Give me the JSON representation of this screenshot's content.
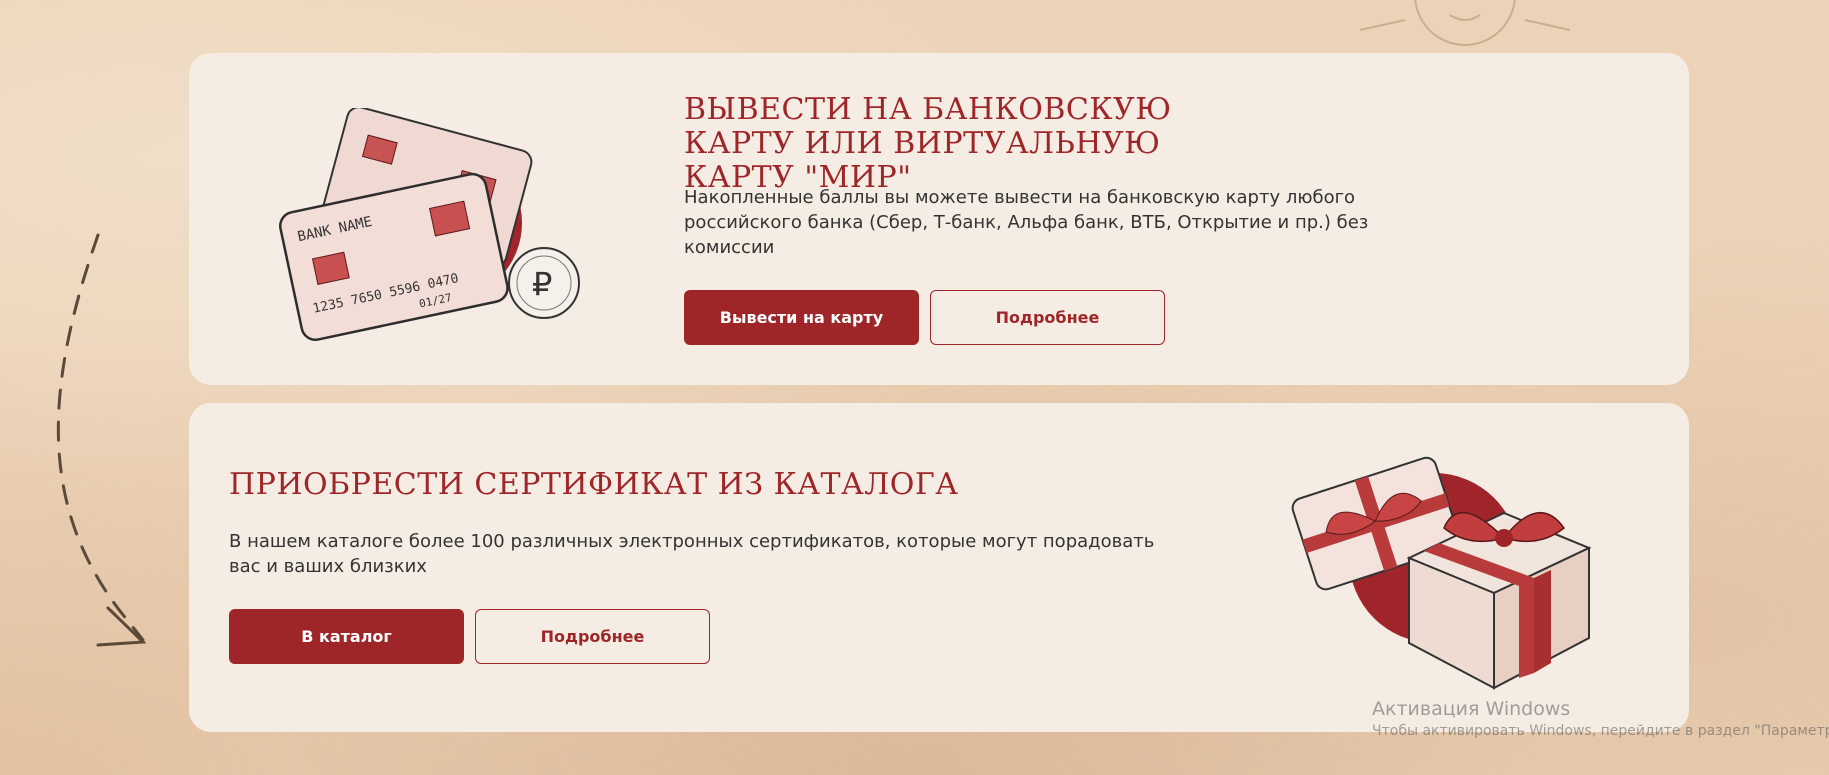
{
  "withdraw_section": {
    "title": "Вывести на банковскую карту или виртуальную карту \"МИР\"",
    "description": "Накопленные баллы вы можете вывести на банковскую карту любого российского банка (Сбер, Т-банк, Альфа банк, ВТБ, Открытие и пр.) без комиссии",
    "primary_button": "Вывести на карту",
    "secondary_button": "Подробнее",
    "illustration_texts": {
      "bank_name": "BANK NAME",
      "card_number": "1235 7650 5596 0470",
      "expiry": "01/27"
    }
  },
  "catalog_section": {
    "title": "Приобрести сертификат из каталога",
    "description": "В нашем каталоге более 100 различных электронных сертификатов, которые могут порадовать вас и ваших близких",
    "primary_button": "В каталог",
    "secondary_button": "Подробнее"
  },
  "windows_activation": {
    "title": "Активация Windows",
    "subtitle": "Чтобы активировать Windows, перейдите в раздел \"Параметры\"."
  },
  "colors": {
    "accent": "#9e2629",
    "card_background": "#f5ede3",
    "page_background": "#ecd3b7",
    "text": "#333333"
  },
  "icons": {
    "cards_illustration": "bank-cards-and-ruble-coin",
    "gifts_illustration": "gift-boxes",
    "decoration_arrow": "dashed-arrow",
    "decoration_sun": "sun-face"
  }
}
